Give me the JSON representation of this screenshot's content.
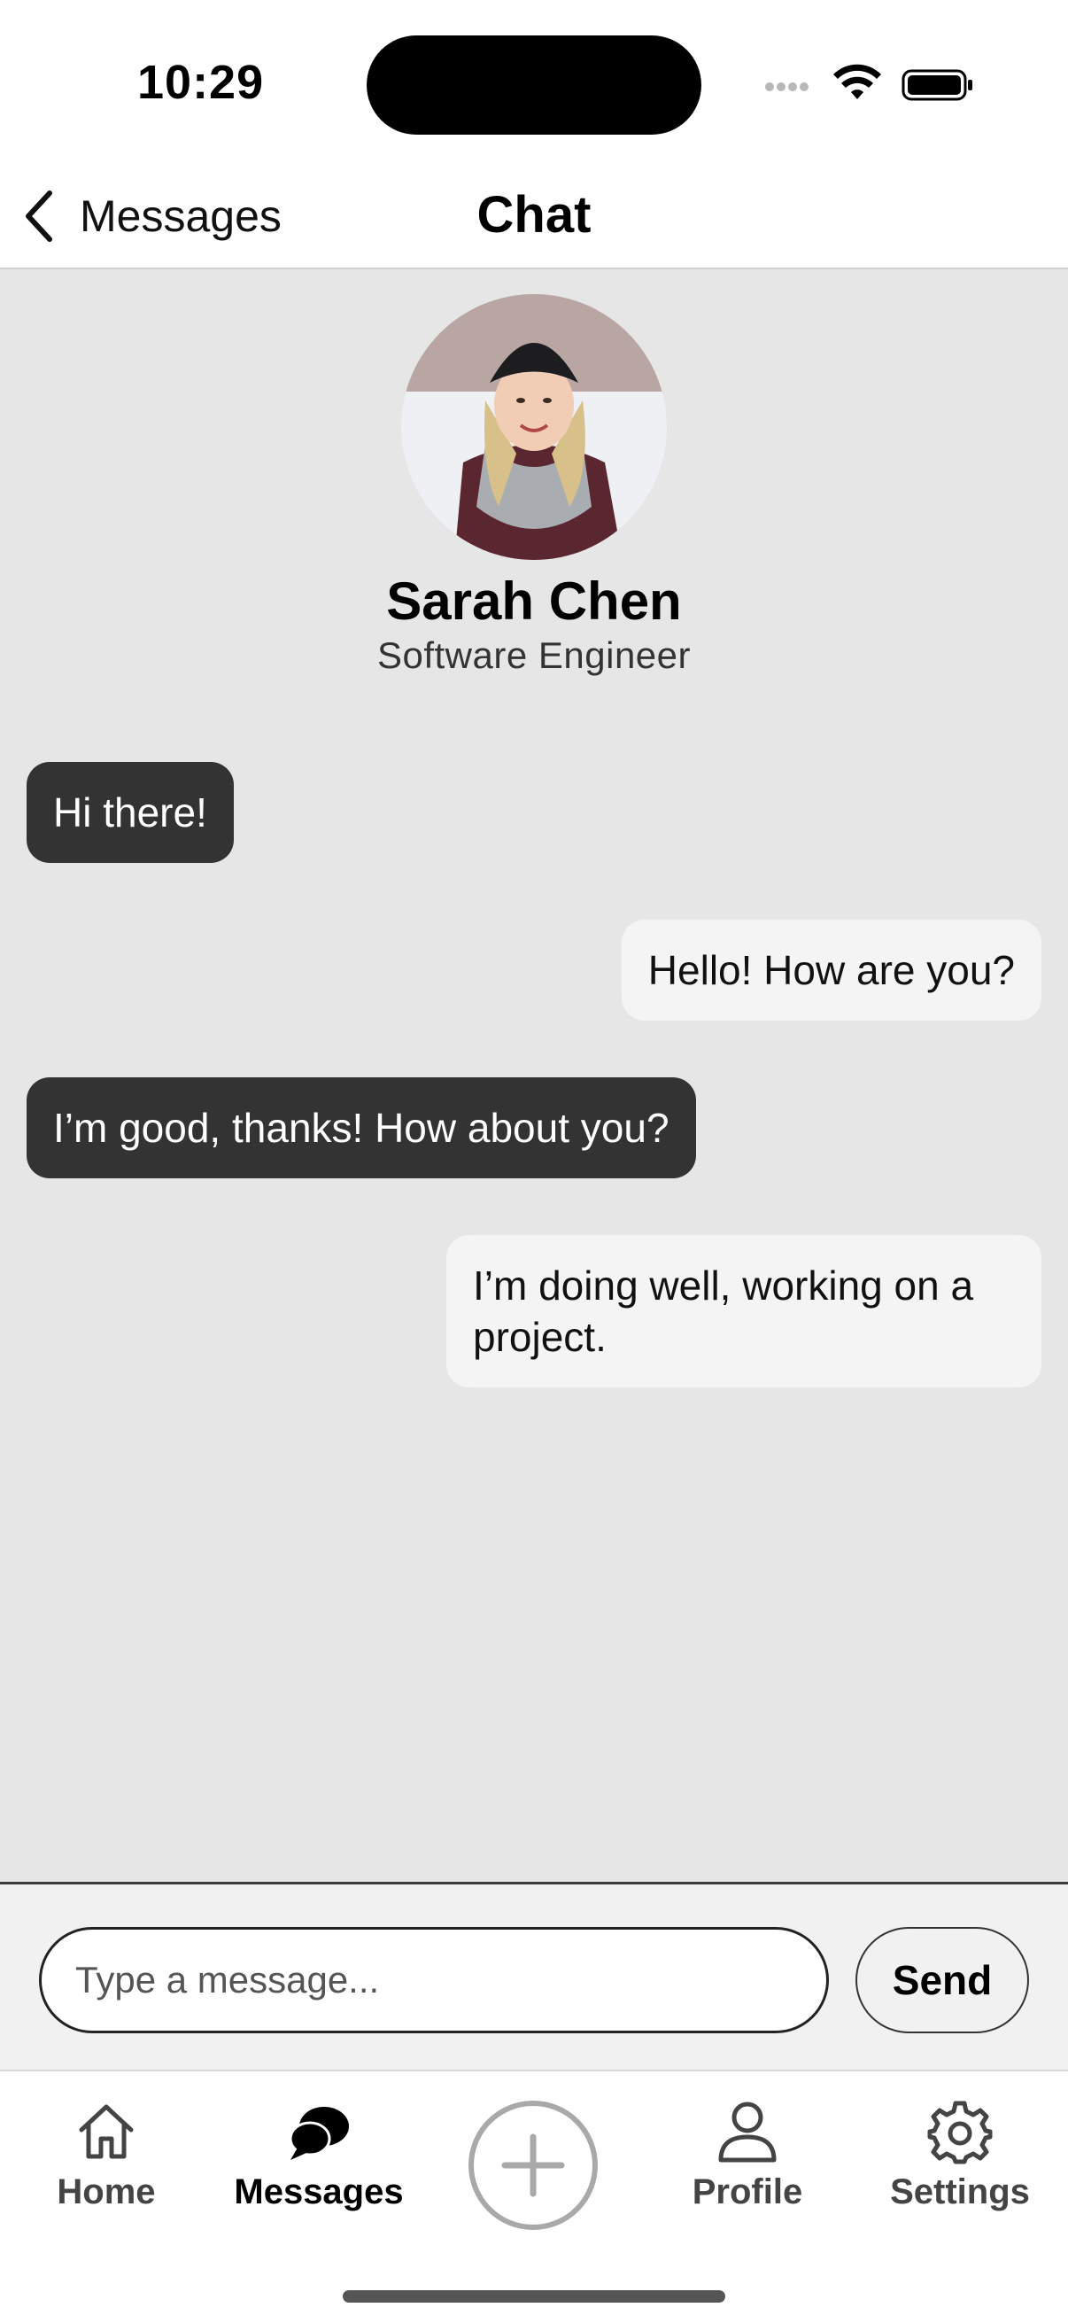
{
  "status_bar": {
    "time": "10:29"
  },
  "nav": {
    "back_label": "Messages",
    "title": "Chat"
  },
  "contact": {
    "name": "Sarah Chen",
    "role": "Software Engineer"
  },
  "messages": [
    {
      "direction": "incoming",
      "text": "Hi there!"
    },
    {
      "direction": "outgoing",
      "text": "Hello! How are you?"
    },
    {
      "direction": "incoming",
      "text": "I’m good, thanks! How about you?"
    },
    {
      "direction": "outgoing",
      "text": "I’m doing well, working on a project."
    }
  ],
  "composer": {
    "placeholder": "Type a message...",
    "value": "",
    "send_label": "Send"
  },
  "tabbar": {
    "items": [
      {
        "label": "Home",
        "icon": "house-icon",
        "active": false
      },
      {
        "label": "Messages",
        "icon": "chat-bubbles-icon",
        "active": true
      },
      {
        "label": "",
        "icon": "plus-circle-icon",
        "active": false
      },
      {
        "label": "Profile",
        "icon": "person-icon",
        "active": false
      },
      {
        "label": "Settings",
        "icon": "gear-icon",
        "active": false
      }
    ]
  },
  "colors": {
    "chat_background": "#e6e6e6",
    "incoming_bubble": "#333333",
    "outgoing_bubble": "#f4f4f4",
    "active_tab": "#000000",
    "inactive_tab": "#444444"
  }
}
